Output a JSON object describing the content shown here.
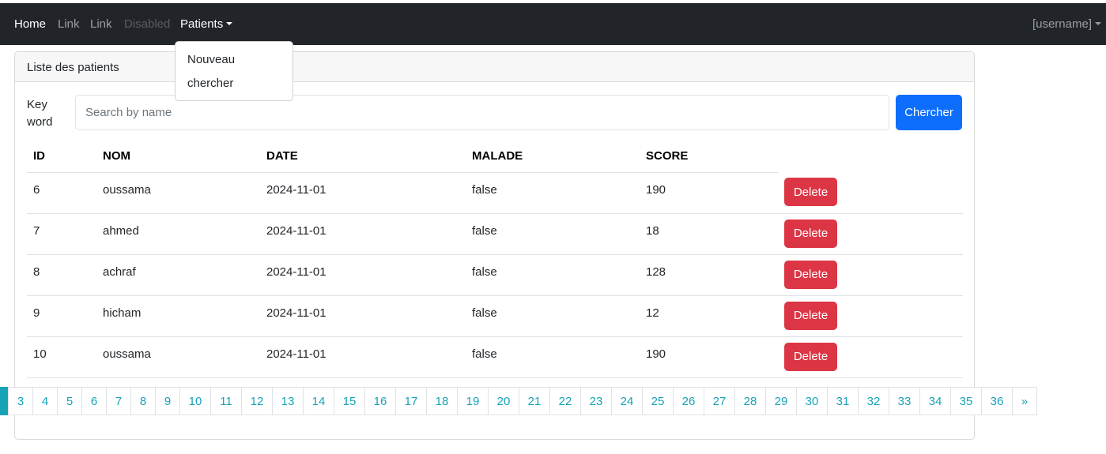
{
  "navbar": {
    "links": [
      {
        "label": "Home",
        "state": "active"
      },
      {
        "label": "Link",
        "state": "normal"
      },
      {
        "label": "Link",
        "state": "normal"
      },
      {
        "label": "Disabled",
        "state": "disabled"
      }
    ],
    "patients_menu_label": "Patients",
    "user_label": "[username]"
  },
  "dropdown": {
    "items": [
      "Nouveau",
      "chercher"
    ]
  },
  "card": {
    "title": "Liste des patients",
    "search": {
      "label": "Key word",
      "placeholder": "Search by name",
      "value": "",
      "button_label": "Chercher"
    },
    "table": {
      "headers": [
        "ID",
        "NOM",
        "DATE",
        "MALADE",
        "SCORE"
      ],
      "action_label": "Delete",
      "rows": [
        {
          "id": "6",
          "nom": "oussama",
          "date": "2024-11-01",
          "malade": "false",
          "score": "190"
        },
        {
          "id": "7",
          "nom": "ahmed",
          "date": "2024-11-01",
          "malade": "false",
          "score": "18"
        },
        {
          "id": "8",
          "nom": "achraf",
          "date": "2024-11-01",
          "malade": "false",
          "score": "128"
        },
        {
          "id": "9",
          "nom": "hicham",
          "date": "2024-11-01",
          "malade": "false",
          "score": "12"
        },
        {
          "id": "10",
          "nom": "oussama",
          "date": "2024-11-01",
          "malade": "false",
          "score": "190"
        }
      ]
    }
  },
  "pagination": {
    "pages": [
      "3",
      "4",
      "5",
      "6",
      "7",
      "8",
      "9",
      "10",
      "11",
      "12",
      "13",
      "14",
      "15",
      "16",
      "17",
      "18",
      "19",
      "20",
      "21",
      "22",
      "23",
      "24",
      "25",
      "26",
      "27",
      "28",
      "29",
      "30",
      "31",
      "32",
      "33",
      "34",
      "35",
      "36"
    ],
    "next_label": "»"
  },
  "colors": {
    "navbar_bg": "#212529",
    "primary": "#0d6efd",
    "danger": "#dc3545",
    "page_link": "#17a2b8"
  }
}
